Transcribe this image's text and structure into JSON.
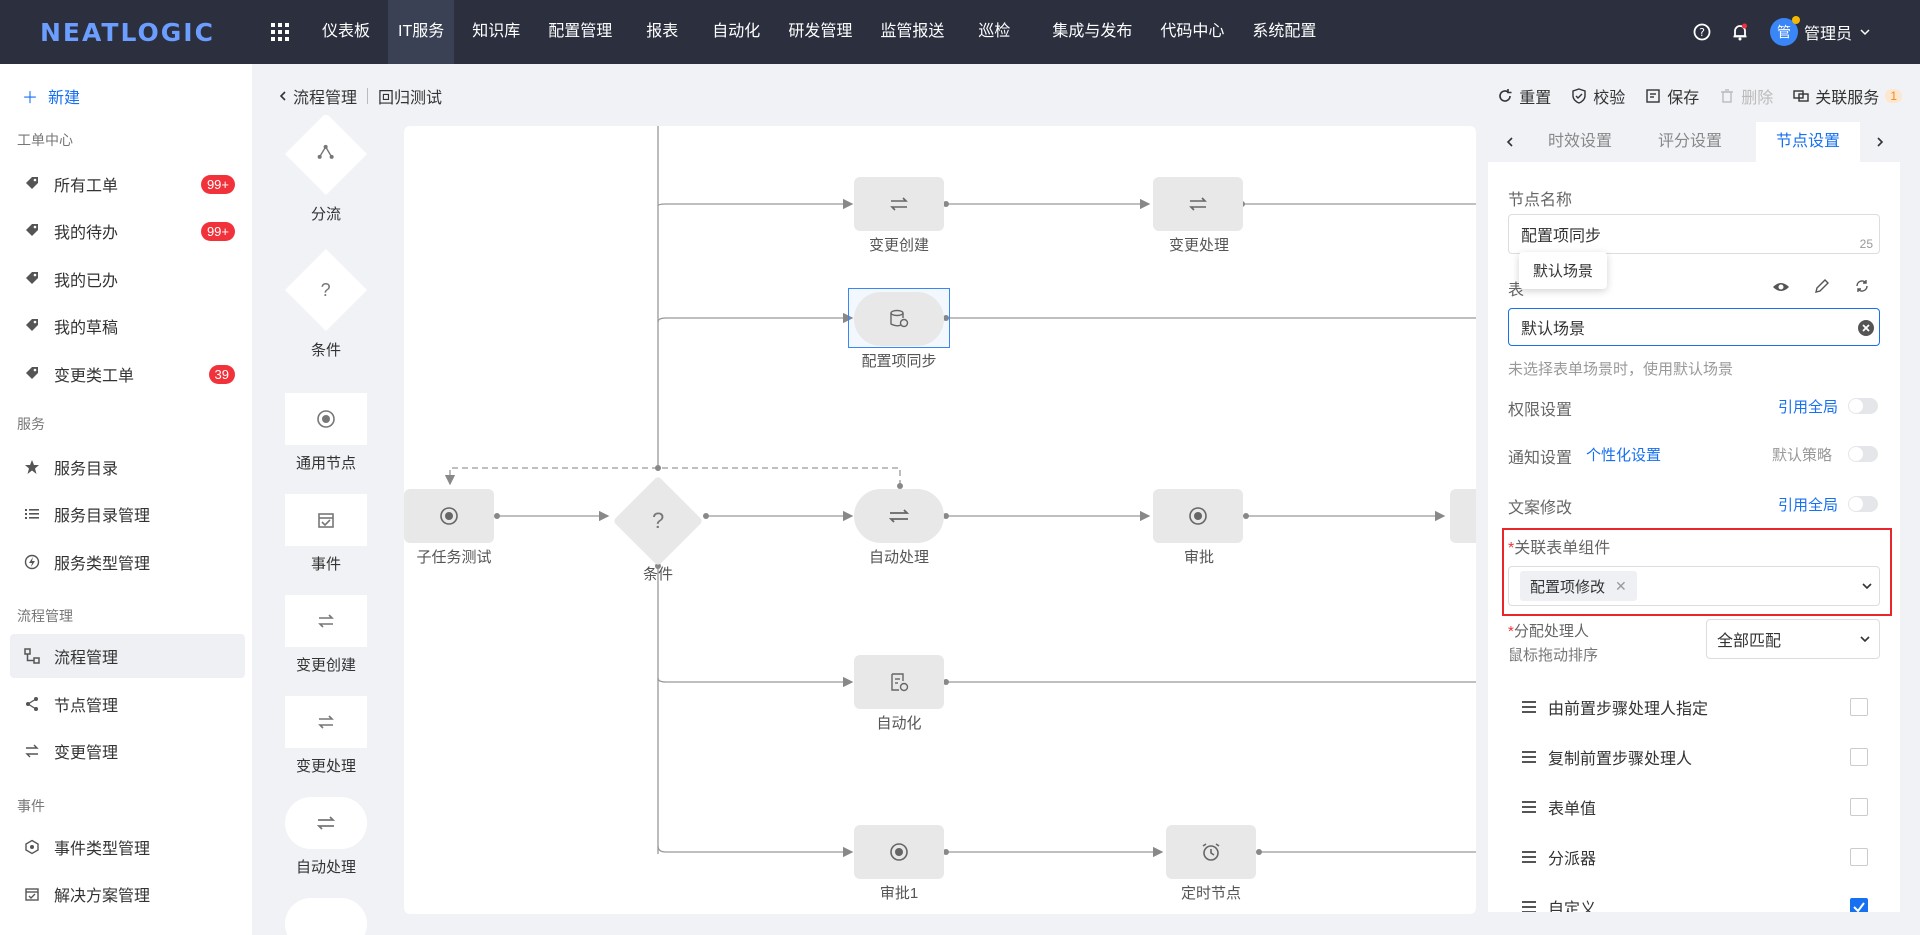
{
  "topbar": {
    "logo": "NEATLOGIC",
    "nav": [
      "仪表板",
      "IT服务",
      "知识库",
      "配置管理",
      "报表",
      "自动化",
      "研发管理",
      "监管报送",
      "巡检",
      "集成与发布",
      "代码中心",
      "系统配置"
    ],
    "active_nav": "IT服务",
    "avatar_char": "管",
    "user": "管理员"
  },
  "sidebar": {
    "new_label": "新建",
    "sec_workorder": "工单中心",
    "all_orders": "所有工单",
    "all_orders_badge": "99+",
    "my_todo": "我的待办",
    "my_todo_badge": "99+",
    "my_done": "我的已办",
    "my_draft": "我的草稿",
    "change_orders": "变更类工单",
    "change_orders_badge": "39",
    "sec_service": "服务",
    "service_catalog": "服务目录",
    "catalog_mgmt": "服务目录管理",
    "service_type_mgmt": "服务类型管理",
    "sec_flow": "流程管理",
    "flow_mgmt": "流程管理",
    "node_mgmt": "节点管理",
    "change_mgmt": "变更管理",
    "sec_event": "事件",
    "event_type_mgmt": "事件类型管理",
    "solution_mgmt": "解决方案管理"
  },
  "breadcrumb": {
    "parent": "流程管理",
    "current": "回归测试"
  },
  "toolbar": {
    "reset": "重置",
    "validate": "校验",
    "save": "保存",
    "delete": "删除",
    "related": "关联服务",
    "related_count": "1"
  },
  "palette": [
    "分流",
    "条件",
    "通用节点",
    "事件",
    "变更创建",
    "变更处理",
    "自动处理"
  ],
  "flow": {
    "change_create": "变更创建",
    "change_handle": "变更处理",
    "ci_sync": "配置项同步",
    "subtask": "子任务测试",
    "condition": "条件",
    "auto_process": "自动处理",
    "approve": "审批",
    "automation": "自动化",
    "approve1": "审批1",
    "timer": "定时节点",
    "condition_mark": "?"
  },
  "panel": {
    "tabs": [
      "时效设置",
      "评分设置",
      "节点设置"
    ],
    "active_tab": "节点设置",
    "node_name_label": "节点名称",
    "node_name_value": "配置项同步",
    "node_name_count": "25",
    "form_scene_label_partial": "表",
    "tooltip": "默认场景",
    "form_scene_value": "默认场景",
    "form_scene_hint": "未选择表单场景时，使用默认场景",
    "perm_label": "权限设置",
    "perm_link": "引用全局",
    "notify_label": "通知设置",
    "notify_link": "个性化设置",
    "notify_right": "默认策略",
    "copy_label": "文案修改",
    "copy_link": "引用全局",
    "form_comp_label": "关联表单组件",
    "form_comp_tag": "配置项修改",
    "assign_label": "分配处理人",
    "assign_sub": "鼠标拖动排序",
    "assign_select": "全部匹配",
    "assign_rows": [
      {
        "label": "由前置步骤处理人指定",
        "checked": false
      },
      {
        "label": "复制前置步骤处理人",
        "checked": false
      },
      {
        "label": "表单值",
        "checked": false
      },
      {
        "label": "分派器",
        "checked": false
      },
      {
        "label": "自定义",
        "checked": true
      }
    ],
    "required_mark": "*"
  },
  "colors": {
    "accent": "#1670f0",
    "topbar": "#2b2f3e",
    "badge": "#f2323a",
    "highlight": "#e8262b"
  }
}
